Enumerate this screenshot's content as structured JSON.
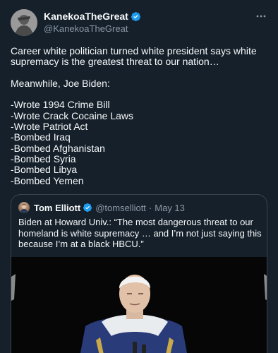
{
  "author": {
    "display_name": "KanekoaTheGreat",
    "handle": "@KanekoaTheGreat",
    "verified_icon": "verified-badge-icon",
    "avatar_icon": "profile-avatar"
  },
  "body": {
    "paragraph1": "Career white politician turned white president says white supremacy is the greatest threat to our nation…",
    "paragraph2": "Meanwhile, Joe Biden:",
    "list": [
      "-Wrote 1994 Crime Bill",
      "-Wrote Crack Cocaine Laws",
      "-Wrote Patriot Act",
      "-Bombed Iraq",
      "-Bombed Afghanistan",
      "-Bombed Syria",
      "-Bombed Libya",
      "-Bombed Yemen"
    ]
  },
  "quoted": {
    "display_name": "Tom Elliott",
    "handle": "@tomselliott",
    "separator": "·",
    "date": "May 13",
    "text": "Biden at Howard Univ.: “The most dangerous threat to our homeland is white supremacy … and I’m not just saying this because I’m at a black HBCU.”"
  },
  "colors": {
    "background": "#15202b",
    "text": "#f7f9f9",
    "secondary": "#8b98a5",
    "verified": "#1d9bf0",
    "border": "#38444d"
  },
  "icons": {
    "more": "more-options-icon",
    "verified": "verified-badge-icon"
  }
}
